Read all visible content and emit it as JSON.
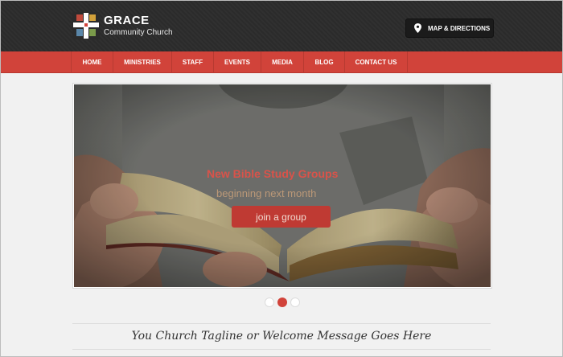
{
  "header": {
    "brand_name": "GRACE",
    "brand_sub": "Community Church",
    "map_button": "MAP & DIRECTIONS",
    "logo_icon": "cross-logo-icon",
    "map_icon": "map-pin-icon"
  },
  "nav": {
    "items": [
      {
        "label": "HOME"
      },
      {
        "label": "MINISTRIES"
      },
      {
        "label": "STAFF"
      },
      {
        "label": "EVENTS"
      },
      {
        "label": "MEDIA"
      },
      {
        "label": "BLOG"
      },
      {
        "label": "CONTACT US"
      }
    ]
  },
  "slider": {
    "headline": "New Bible Study Groups",
    "subline": "beginning next month",
    "cta_label": "join a group",
    "active_slide": 2,
    "total_slides": 3
  },
  "tagline": "You Church Tagline or Welcome Message Goes Here",
  "colors": {
    "accent": "#d1433a",
    "header_bg": "#2b2b2b",
    "page_bg": "#f1f1f1"
  }
}
